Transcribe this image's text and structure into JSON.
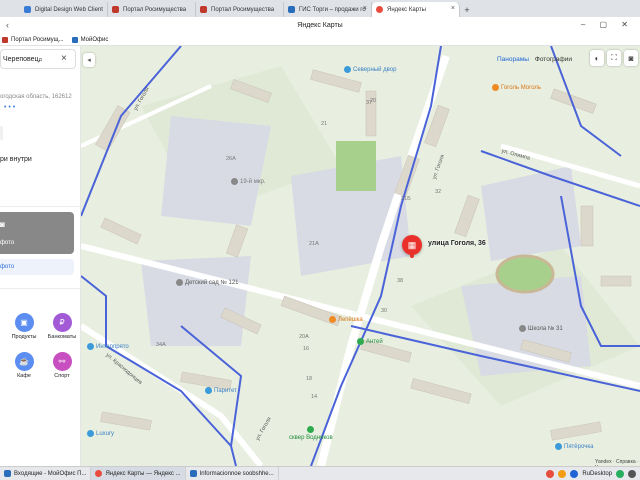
{
  "browser": {
    "tabs": [
      {
        "label": "Digital Design Web Client",
        "color": "#3a7bd5",
        "active": false
      },
      {
        "label": "Портал Росимущества",
        "color": "#c0392b",
        "active": false
      },
      {
        "label": "Портал Росимущества",
        "color": "#c0392b",
        "active": false
      },
      {
        "label": "ГИС Торги – продажи го",
        "color": "#2a6ebb",
        "active": false
      },
      {
        "label": "Яндекс Карты",
        "color": "#e74c3c",
        "active": true
      }
    ],
    "page_title": "Яндекс Карты",
    "bookmarks": [
      {
        "label": "Портал Росимущ...",
        "color": "#c0392b"
      },
      {
        "label": "МойОфис",
        "color": "#2a6ebb"
      }
    ]
  },
  "sidebar": {
    "search_value": "Череповец,",
    "address_line": "огодская область, 162612",
    "dots": "• • •",
    "inside_label": "ри внутри",
    "photo_label": "фото",
    "add_photo_label": "фото",
    "categories": [
      {
        "label": "Продукты",
        "icon": "cart-icon",
        "glyph": "🛒",
        "color": "#5c8ef2"
      },
      {
        "label": "Банкоматы",
        "icon": "ruble-icon",
        "glyph": "₽",
        "color": "#a25ad6"
      },
      {
        "label": "Кафе",
        "icon": "coffee-icon",
        "glyph": "☕",
        "color": "#5c8ef2"
      },
      {
        "label": "Спорт",
        "icon": "dumbbell-icon",
        "glyph": "⚲",
        "color": "#c84fc0"
      }
    ]
  },
  "map": {
    "layer_tabs": [
      "Панорамы",
      "Фотографии"
    ],
    "active_layer": "Панорамы",
    "pin_label": "улица Гоголя, 36",
    "pois": [
      {
        "label": "Северный двор",
        "color": "#3b9ad9"
      },
      {
        "label": "Гоголь Моголь",
        "color": "#f08a24"
      },
      {
        "label": "Детский сад № 121",
        "color": "#888888"
      },
      {
        "label": "Лепёшка",
        "color": "#f08a24"
      },
      {
        "label": "Антей",
        "color": "#2eaa4f"
      },
      {
        "label": "Интерпрято",
        "color": "#3b9ad9"
      },
      {
        "label": "Паритет",
        "color": "#3b9ad9"
      },
      {
        "label": "Школа № 31",
        "color": "#888888"
      },
      {
        "label": "сквер Водников",
        "color": "#2eaa4f"
      },
      {
        "label": "Пятёрочка",
        "color": "#3b9ad9"
      },
      {
        "label": "Luxury",
        "color": "#3b9ad9"
      },
      {
        "label": "19-й мкр.",
        "color": "#888888"
      }
    ],
    "streets": [
      "ул. Гоголя",
      "ул. Гоголя",
      "ул. Краснодонцев",
      "ул. Олимпа",
      "ул. Гоголя"
    ],
    "house_numbers": [
      "20",
      "21",
      "21Б",
      "21А",
      "26А",
      "32",
      "38",
      "37",
      "30",
      "20А",
      "16",
      "18",
      "14",
      "34А"
    ],
    "attribution": "Yandex · Справка · Условия"
  },
  "taskbar": {
    "items": [
      {
        "label": "Входящие - МойОфис П...",
        "color": "#2a6ebb"
      },
      {
        "label": "Яндекс Карты — Яндекс ...",
        "color": "#e74c3c"
      },
      {
        "label": "Informacionnoe soobshhe...",
        "color": "#2a6ebb"
      }
    ],
    "tray_label": "RuDesktop"
  }
}
